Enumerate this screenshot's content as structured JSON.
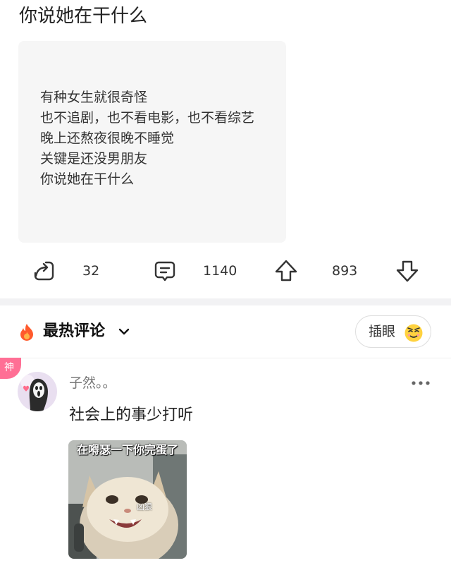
{
  "post": {
    "title": "你说她在干什么",
    "quote_lines": [
      "有种女生就很奇怪",
      "也不追剧，也不看电影，也不看综艺",
      "晚上还熬夜很晚不睡觉",
      "关键是还没男朋友",
      "你说她在干什么"
    ]
  },
  "actions": {
    "share_count": "32",
    "comment_count": "1140",
    "upvote_count": "893"
  },
  "comments_header": {
    "title": "最热评论",
    "insert_eye_label": "插眼"
  },
  "comment": {
    "badge": "神",
    "username": "子然。。",
    "text": "社会上的事少打听",
    "meme_caption": "在嘚瑟一下你完蛋了",
    "meme_sublabel": "凶狠"
  },
  "icons": {
    "share": "share-icon",
    "comment": "comment-icon",
    "upvote": "upvote-icon",
    "downvote": "downvote-icon",
    "hot": "fire-icon",
    "dropdown": "chevron-down-icon",
    "more": "more-icon"
  },
  "colors": {
    "badge": "#ff6f95",
    "fire": "#ff5a2c",
    "card_bg": "#f6f6f6"
  }
}
